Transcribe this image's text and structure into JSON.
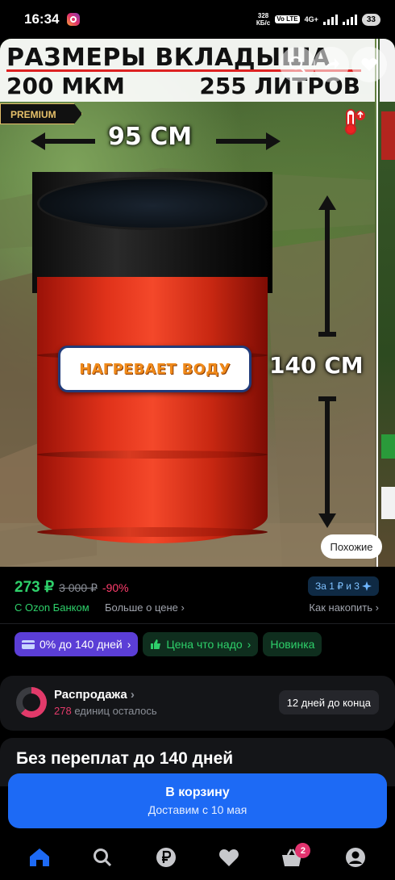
{
  "status_bar": {
    "time": "16:34",
    "net_speed_value": "328",
    "net_speed_unit": "КБ/с",
    "volte": "Vo LTE",
    "network": "4G+",
    "battery": "33"
  },
  "hero": {
    "title_line1": "РАЗМЕРЫ ВКЛАДЫША",
    "title_line2_left": "200 МКМ",
    "title_line2_right": "255 ЛИТРОВ",
    "premium": "PREMIUM",
    "width_label": "95 СМ",
    "height_label": "140 СМ",
    "badge": "НАГРЕВАЕТ ВОДУ",
    "similar_button": "Похожие"
  },
  "price": {
    "current": "273 ₽",
    "old": "3 000 ₽",
    "discount": "-90%",
    "bank": "С Ozon Банком",
    "more_about_price": "Больше о цене",
    "points_pill": "За 1 ₽ и 3",
    "how_to_save": "Как накопить"
  },
  "chips": [
    {
      "label": "0% до 140 дней",
      "style": "purple"
    },
    {
      "label": "Цена что надо",
      "style": "green"
    },
    {
      "label": "Новинка",
      "style": "green"
    }
  ],
  "sale": {
    "title": "Распродажа",
    "remaining_count": "278",
    "remaining_text": "единиц осталось",
    "days_left": "12 дней до конца"
  },
  "no_overpay": {
    "title": "Без переплат до 140 дней"
  },
  "cart": {
    "title": "В корзину",
    "subtitle": "Доставим с 10 мая"
  },
  "bottom_nav": {
    "items": [
      {
        "icon": "home-icon",
        "active": true
      },
      {
        "icon": "search-icon"
      },
      {
        "icon": "ruble-icon"
      },
      {
        "icon": "heart-icon"
      },
      {
        "icon": "cart-icon",
        "badge": "2"
      },
      {
        "icon": "profile-icon"
      }
    ]
  },
  "colors": {
    "accent_blue": "#1d6af5",
    "price_green": "#2ed06a",
    "discount_pink": "#ff3d6c",
    "chip_purple": "#5b3ed6"
  }
}
